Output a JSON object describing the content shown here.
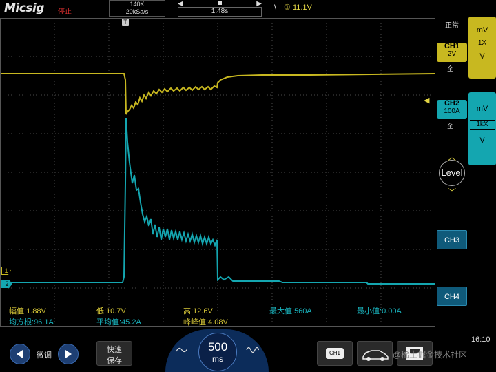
{
  "header": {
    "brand": "Micsig",
    "run_status": "停止",
    "memory_depth": "140K",
    "sample_rate": "20kSa/s",
    "time_delay": "1.48s",
    "time_left_arrow": "◀",
    "time_right_arrow": "▶",
    "trigger_source_marker": "①",
    "trigger_level": "11.1V",
    "trigger_slope": "\\"
  },
  "right_panel": {
    "mode_label": "正常",
    "ch1": {
      "label": "CH1",
      "scale": "2V",
      "coupling": "全",
      "unit": "mV",
      "probe": "1X",
      "unit2": "V",
      "color": "#c8b820"
    },
    "ch2": {
      "label": "CH2",
      "scale": "100A",
      "coupling": "全",
      "unit": "mV",
      "probe": "1kX",
      "unit2": "V",
      "color": "#14a6b0"
    },
    "level_label": "Level",
    "ch3_label": "CH3",
    "ch4_label": "CH4"
  },
  "markers": {
    "ch1_ground": "1",
    "ch2_ground": "2",
    "trigger_position": "T"
  },
  "measurements": [
    {
      "label": "幅值:",
      "value": "1.88V",
      "color": "#d8c838"
    },
    {
      "label": "低:",
      "value": "10.7V",
      "color": "#d8c838"
    },
    {
      "label": "高:",
      "value": "12.6V",
      "color": "#d8c838"
    },
    {
      "label": "最大值:",
      "value": "560A",
      "color": "#19b3bd"
    },
    {
      "label": "最小值:",
      "value": "0.00A",
      "color": "#19b3bd"
    },
    {
      "label": "均方根:",
      "value": "96.1A",
      "color": "#19b3bd"
    },
    {
      "label": "平均值:",
      "value": "45.2A",
      "color": "#19b3bd"
    },
    {
      "label": "峰峰值:",
      "value": "4.08V",
      "color": "#d8c838"
    }
  ],
  "bottom": {
    "fine_label": "微调",
    "quick_save_line1": "快速",
    "quick_save_line2": "保存",
    "timebase_value": "500",
    "timebase_unit": "ms",
    "ch1_chip": "CH1",
    "clock": "16:10",
    "watermark": "@稀土掘金技术社区"
  },
  "colors": {
    "ch1": "#c8b820",
    "ch2": "#14a6b0",
    "background": "#000000",
    "grid": "#4a4a4a"
  }
}
